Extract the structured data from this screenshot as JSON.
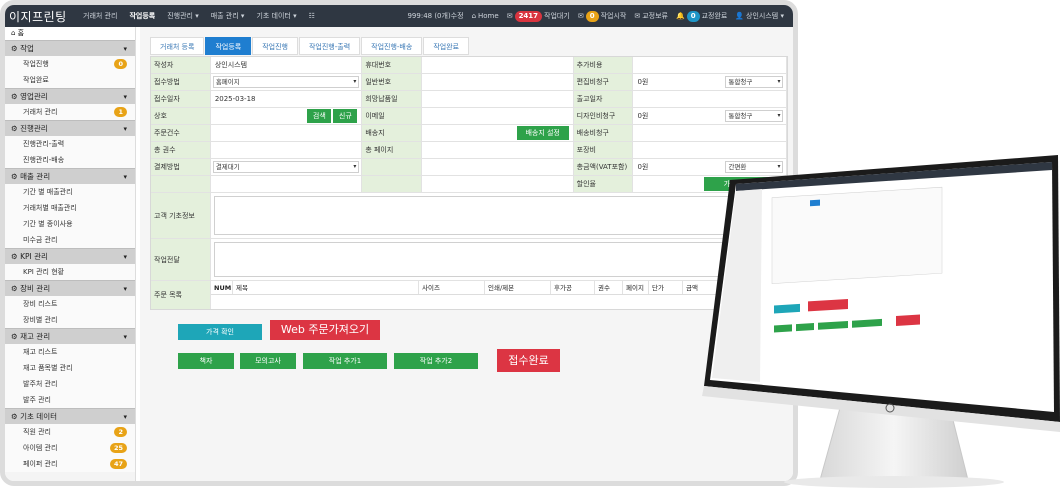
{
  "app": {
    "brand": "이지프린팅",
    "nav": [
      "거래처 관리",
      "작업등록",
      "진행관리 ▾",
      "매출 관리 ▾",
      "기초 데이터 ▾",
      "☷"
    ],
    "nav_active_index": 1,
    "status": {
      "time": "999:48 (0개)수정",
      "home": "Home",
      "wait_count": "2417",
      "wait_label": "작업대기",
      "start_count": "0",
      "start_label": "작업시작",
      "proof_label": "교정보류",
      "done_count": "0",
      "done_label": "교정완료",
      "user_label": "상인시스템 ▾"
    },
    "badge_colors": {
      "red": "#d9343f",
      "yellow": "#e8a317",
      "blue": "#1e96c8",
      "green": "#2ea24a",
      "teal": "#1ea6b8"
    }
  },
  "sidebar": {
    "home": "홈",
    "sections": [
      {
        "title": "작업",
        "items": [
          {
            "label": "작업진행",
            "badge": "0"
          },
          {
            "label": "작업완료",
            "badge": ""
          }
        ]
      },
      {
        "title": "영업관리",
        "items": [
          {
            "label": "거래처 관리",
            "badge": "1"
          }
        ]
      },
      {
        "title": "진행관리",
        "items": [
          {
            "label": "진행관리-출력",
            "badge": ""
          },
          {
            "label": "진행관리-배송",
            "badge": ""
          }
        ]
      },
      {
        "title": "매출 관리",
        "items": [
          {
            "label": "기간 별 매출관리",
            "badge": ""
          },
          {
            "label": "거래처별 매출관리",
            "badge": ""
          },
          {
            "label": "기간 별 종이사용",
            "badge": ""
          },
          {
            "label": "미수금 관리",
            "badge": ""
          }
        ]
      },
      {
        "title": "KPI 관리",
        "items": [
          {
            "label": "KPI 관리 현황",
            "badge": ""
          }
        ]
      },
      {
        "title": "장비 관리",
        "items": [
          {
            "label": "장비 리스트",
            "badge": ""
          },
          {
            "label": "장비별 관리",
            "badge": ""
          }
        ]
      },
      {
        "title": "재고 관리",
        "items": [
          {
            "label": "재고 리스트",
            "badge": ""
          },
          {
            "label": "재고 품목별 관리",
            "badge": ""
          },
          {
            "label": "발주처 관리",
            "badge": ""
          },
          {
            "label": "발주 관리",
            "badge": ""
          }
        ]
      },
      {
        "title": "기초 데이터",
        "items": [
          {
            "label": "직원 관리",
            "badge": "2"
          },
          {
            "label": "아이템 관리",
            "badge": "25"
          },
          {
            "label": "페이퍼 관리",
            "badge": "47"
          }
        ]
      }
    ]
  },
  "tabs": [
    "거래처 등록",
    "작업등록",
    "작업진행",
    "작업진행-출력",
    "작업진행-배송",
    "작업완료"
  ],
  "tab_active_index": 1,
  "form": {
    "rows": [
      [
        {
          "label": "작성자",
          "value": "상인시스템"
        },
        {
          "label": "휴대번호",
          "value": ""
        },
        {
          "label": "추가비용",
          "value": ""
        }
      ],
      [
        {
          "label": "접수방법",
          "select": "홈페이지"
        },
        {
          "label": "일반번호",
          "value": ""
        },
        {
          "label": "편집비청구",
          "value": "0원",
          "select": "통합청구"
        }
      ],
      [
        {
          "label": "접수일자",
          "value": "2025-03-18"
        },
        {
          "label": "희망납품일",
          "value": ""
        },
        {
          "label": "출고일자",
          "value": ""
        }
      ],
      [
        {
          "label": "상호",
          "buttons": [
            "검색",
            "신규"
          ]
        },
        {
          "label": "이메일",
          "value": ""
        },
        {
          "label": "디자인비청구",
          "value": "0원",
          "select": "통합청구"
        }
      ],
      [
        {
          "label": "주문건수",
          "value": ""
        },
        {
          "label": "배송지",
          "buttons": [
            "배송지 설정"
          ]
        },
        {
          "label": "배송비청구",
          "value": ""
        }
      ],
      [
        {
          "label": "총 권수",
          "value": ""
        },
        {
          "label": "총 페이지",
          "value": ""
        },
        {
          "label": "포장비",
          "value": ""
        }
      ],
      [
        {
          "label": "결제방법",
          "select": "결제대기"
        },
        {
          "label": "",
          "value": ""
        },
        {
          "label": "총금액(VAT포함)",
          "value": "0원",
          "select": "간편환"
        }
      ],
      [
        {
          "label": "",
          "value": ""
        },
        {
          "label": "",
          "value": ""
        },
        {
          "label": "할인율",
          "buttons": [
            "가격다시계산"
          ]
        }
      ]
    ],
    "customer_info_label": "고객 기초정보",
    "work_note_label": "작업전달",
    "order_list_label": "주문 목록",
    "order_columns": [
      "NUM",
      "제목",
      "사이즈",
      "인쇄/제본",
      "후가공",
      "권수",
      "페이지",
      "단가",
      "금액"
    ]
  },
  "actions": {
    "price_check": "가격 확인",
    "web_import": "Web 주문가져오기",
    "book": "책자",
    "mock_exam": "모의고사",
    "add_work1": "작업 추가1",
    "add_work2": "작업 추가2",
    "complete": "접수완료"
  }
}
